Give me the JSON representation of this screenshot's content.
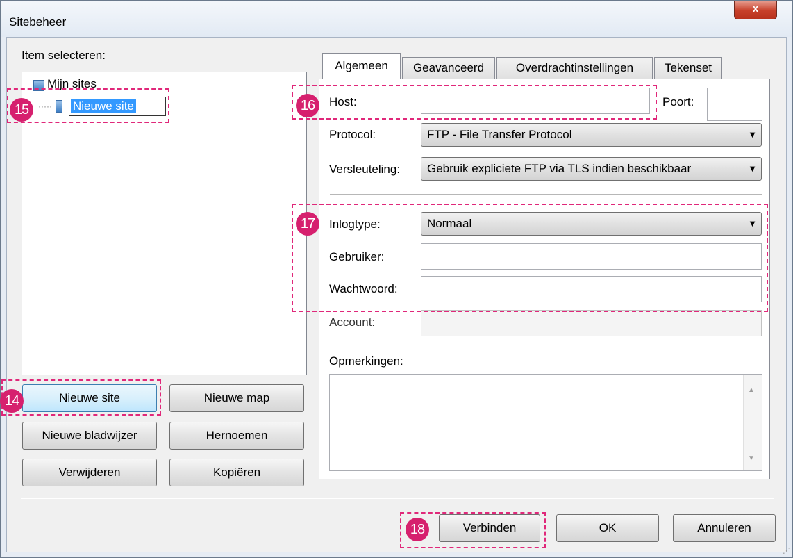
{
  "window": {
    "title": "Sitebeheer",
    "close_symbol": "x"
  },
  "left": {
    "select_label": "Item selecteren:",
    "tree": {
      "root": "Mijn sites",
      "child_editing": "Nieuwe site"
    },
    "buttons": {
      "new_site": "Nieuwe site",
      "new_folder": "Nieuwe map",
      "new_bookmark": "Nieuwe bladwijzer",
      "rename": "Hernoemen",
      "delete": "Verwijderen",
      "copy": "Kopiëren"
    }
  },
  "tabs": [
    "Algemeen",
    "Geavanceerd",
    "Overdrachtinstellingen",
    "Tekenset"
  ],
  "general": {
    "host_label": "Host:",
    "host_value": "",
    "port_label": "Poort:",
    "port_value": "",
    "protocol_label": "Protocol:",
    "protocol_value": "FTP - File Transfer Protocol",
    "encryption_label": "Versleuteling:",
    "encryption_value": "Gebruik expliciete FTP via TLS indien beschikbaar",
    "logon_label": "Inlogtype:",
    "logon_value": "Normaal",
    "user_label": "Gebruiker:",
    "user_value": "",
    "password_label": "Wachtwoord:",
    "password_value": "",
    "account_label": "Account:",
    "account_value": "",
    "comments_label": "Opmerkingen:"
  },
  "footer": {
    "connect": "Verbinden",
    "ok": "OK",
    "cancel": "Annuleren"
  },
  "annotations": {
    "b14": "14",
    "b15": "15",
    "b16": "16",
    "b17": "17",
    "b18": "18"
  },
  "colors": {
    "accent_pink": "#d6206e",
    "callout_border": "#e0287a",
    "selection_blue": "#3399ff"
  }
}
